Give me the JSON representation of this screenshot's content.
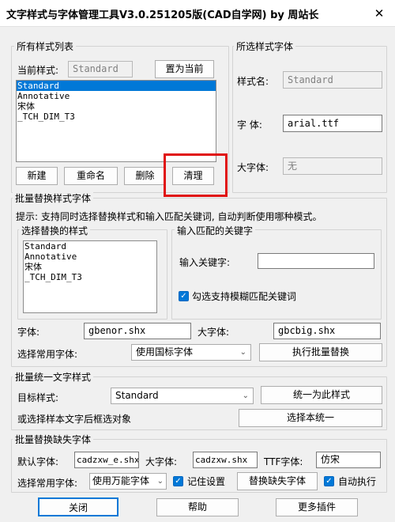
{
  "window": {
    "title": "文字样式与字体管理工具V3.0.251205版(CAD自学网) by 周站长",
    "close": "✕"
  },
  "style_list": {
    "group_label": "所有样式列表",
    "current_label": "当前样式:",
    "current_value": "Standard",
    "set_current": "置为当前",
    "items": [
      "Standard",
      "Annotative",
      "宋体",
      "_TCH_DIM_T3"
    ],
    "btn_new": "新建",
    "btn_rename": "重命名",
    "btn_delete": "删除",
    "btn_clean": "清理"
  },
  "selected_font": {
    "group_label": "所选样式字体",
    "style_label": "样式名:",
    "style_value": "Standard",
    "font_label": "字    体:",
    "font_value": "arial.ttf",
    "bigfont_label": "大字体:",
    "bigfont_value": "无"
  },
  "batch_replace": {
    "group_label": "批量替换样式字体",
    "hint": "提示: 支持同时选择替换样式和输入匹配关键词, 自动判断使用哪种模式。",
    "select_label": "选择替换的样式",
    "items": [
      "Standard",
      "Annotative",
      "宋体",
      "_TCH_DIM_T3"
    ],
    "keyword_group_label": "输入匹配的关键字",
    "keyword_label": "输入关键字:",
    "keyword_value": "",
    "fuzzy_label": "勾选支持模糊匹配关键词",
    "font_label": "字体:",
    "font_value": "gbenor.shx",
    "bigfont_label": "大字体:",
    "bigfont_value": "gbcbig.shx",
    "common_label": "选择常用字体:",
    "common_value": "使用国标字体",
    "execute": "执行批量替换"
  },
  "unify": {
    "group_label": "批量统一文字样式",
    "target_label": "目标样式:",
    "target_value": "Standard",
    "unify_btn": "统一为此样式",
    "select_label": "或选择样本文字后框选对象",
    "sample_btn": "选择本统一"
  },
  "missing": {
    "group_label": "批量替换缺失字体",
    "default_label": "默认字体:",
    "default_value": "cadzxw_e.shx",
    "bigfont_label": "大字体:",
    "bigfont_value": "cadzxw.shx",
    "ttf_label": "TTF字体:",
    "ttf_value": "仿宋",
    "common_label": "选择常用字体:",
    "common_value": "使用万能字体",
    "remember_label": "记住设置",
    "replace_btn": "替换缺失字体",
    "auto_label": "自动执行"
  },
  "footer": {
    "close": "关闭",
    "help": "帮助",
    "more": "更多插件"
  },
  "colors": {
    "accent": "#0078d7",
    "highlight": "#e01010"
  }
}
